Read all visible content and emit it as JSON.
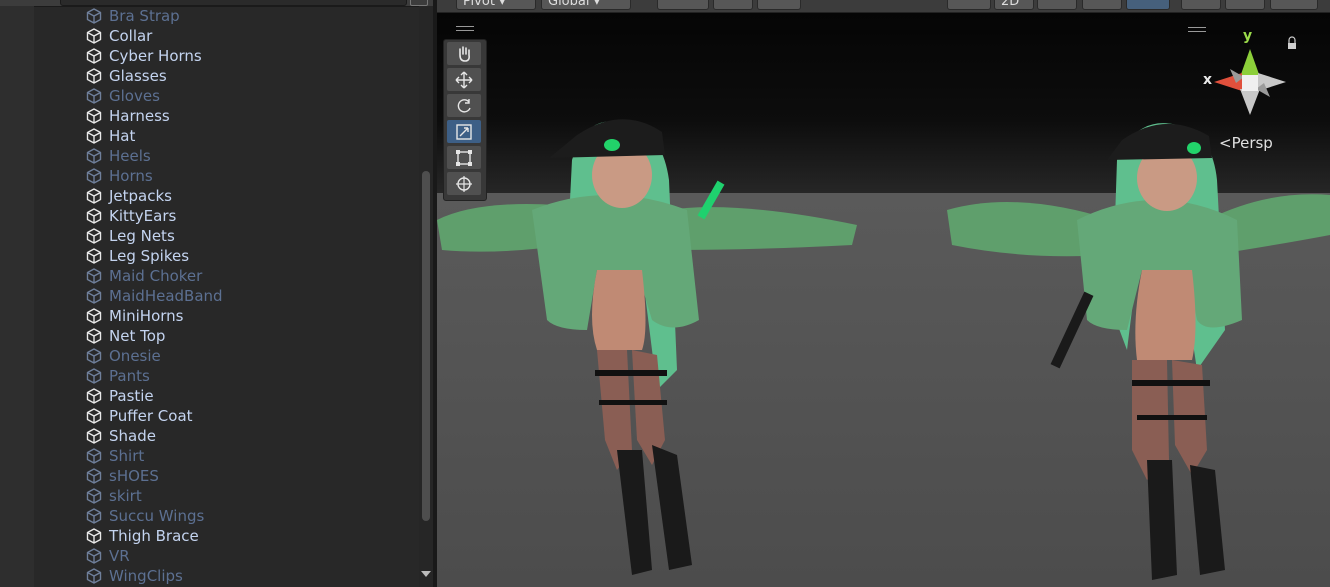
{
  "hierarchy": {
    "items": [
      {
        "label": "Bra Strap",
        "active": false
      },
      {
        "label": "Collar",
        "active": true
      },
      {
        "label": "Cyber Horns",
        "active": true
      },
      {
        "label": "Glasses",
        "active": true
      },
      {
        "label": "Gloves",
        "active": false
      },
      {
        "label": "Harness",
        "active": true
      },
      {
        "label": "Hat",
        "active": true
      },
      {
        "label": "Heels",
        "active": false
      },
      {
        "label": "Horns",
        "active": false
      },
      {
        "label": "Jetpacks",
        "active": true
      },
      {
        "label": "KittyEars",
        "active": true
      },
      {
        "label": "Leg Nets",
        "active": true
      },
      {
        "label": "Leg Spikes",
        "active": true
      },
      {
        "label": "Maid Choker",
        "active": false
      },
      {
        "label": "MaidHeadBand",
        "active": false
      },
      {
        "label": "MiniHorns",
        "active": true
      },
      {
        "label": "Net Top",
        "active": true
      },
      {
        "label": "Onesie",
        "active": false
      },
      {
        "label": "Pants",
        "active": false
      },
      {
        "label": "Pastie",
        "active": true
      },
      {
        "label": "Puffer Coat",
        "active": true
      },
      {
        "label": "Shade",
        "active": true
      },
      {
        "label": "Shirt",
        "active": false
      },
      {
        "label": "sHOES",
        "active": false
      },
      {
        "label": "skirt",
        "active": false
      },
      {
        "label": "Succu Wings",
        "active": false
      },
      {
        "label": "Thigh Brace",
        "active": true
      },
      {
        "label": "VR",
        "active": false
      },
      {
        "label": "WingClips",
        "active": false
      }
    ]
  },
  "scene": {
    "toolbar": {
      "pivot_label": "Pivot",
      "global_label": "Global",
      "mode_2d_label": "2D"
    },
    "tools": [
      "hand-tool",
      "move-tool",
      "rotate-tool",
      "scale-tool",
      "rect-tool",
      "transform-tool"
    ],
    "active_tool": "scale-tool",
    "gizmo": {
      "y_label": "y",
      "x_label": "x",
      "projection_label": "Persp"
    }
  },
  "colors": {
    "active_item": "#c4d4f0",
    "inactive_item": "#5c7092",
    "selected_tool": "#3d5f86",
    "axis_x": "#e0503c",
    "axis_y": "#8ccf3a"
  }
}
